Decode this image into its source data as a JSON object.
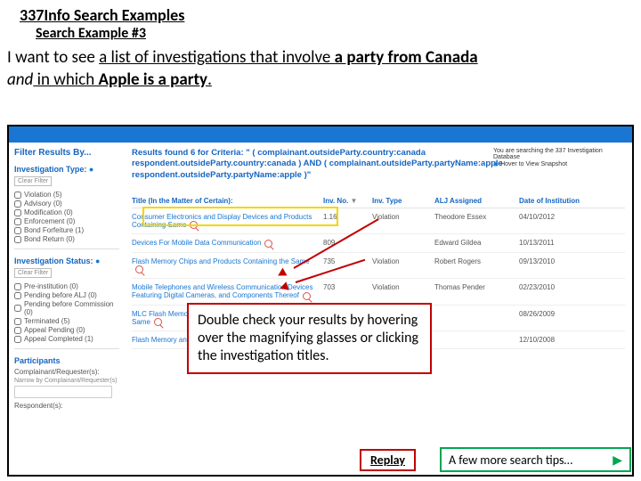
{
  "slide": {
    "title": "337Info Search Examples",
    "subtitle": "Search Example #3",
    "prompt_lead": "I want to see ",
    "prompt_seg1": "a list of investigations that involve ",
    "prompt_seg2": "a party from Canada",
    "prompt_and": "and",
    "prompt_seg3": " in which ",
    "prompt_seg4": "Apple is a party",
    "prompt_period": "."
  },
  "sidebar": {
    "header": "Filter Results By...",
    "group1": "Investigation Type:",
    "clear": "Clear Filter",
    "types": [
      {
        "label": "Violation (5)"
      },
      {
        "label": "Advisory (0)"
      },
      {
        "label": "Modification (0)"
      },
      {
        "label": "Enforcement (0)"
      },
      {
        "label": "Bond Forfeiture (1)"
      },
      {
        "label": "Bond Return (0)"
      }
    ],
    "group2": "Investigation Status:",
    "statuses": [
      {
        "label": "Pre-institution (0)"
      },
      {
        "label": "Pending before ALJ (0)"
      },
      {
        "label": "Pending before Commission (0)"
      },
      {
        "label": "Terminated (5)"
      },
      {
        "label": "Appeal Pending (0)"
      },
      {
        "label": "Appeal Completed (1)"
      }
    ],
    "group3": "Participants",
    "participants_label": "Complainant/Requester(s):",
    "narrow": "Narrow by Complainant/Requester(s)",
    "respondents_label": "Respondent(s):"
  },
  "results": {
    "criteria": "Results found 6 for Criteria: \" ( complainant.outsideParty.country:canada respondent.outsideParty.country:canada ) AND ( complainant.outsideParty.partyName:apple respondent.outsideParty.partyName:apple )\"",
    "aside_line1": "You are searching the 337 Investigation Database",
    "aside_line2": "Hover to View Snapshot",
    "headers": {
      "title": "Title (In the Matter of Certain):",
      "inv": "Inv. No.",
      "type": "Inv. Type",
      "alj": "ALJ Assigned",
      "date": "Date of Institution"
    },
    "rows": [
      {
        "title": "Consumer Electronics and Display Devices and Products Containing Same",
        "inv": "1.16",
        "type": "Violation",
        "alj": "Theodore Essex",
        "date": "04/10/2012"
      },
      {
        "title": "Devices For Mobile Data Communication",
        "inv": "809",
        "type": "",
        "alj": "Edward Gildea",
        "date": "10/13/2011"
      },
      {
        "title": "Flash Memory Chips and Products Containing the Same",
        "inv": "735",
        "type": "Violation",
        "alj": "Robert Rogers",
        "date": "09/13/2010"
      },
      {
        "title": "Mobile Telephones and Wireless Communication Devices Featuring Digital Cameras, and Components Thereof",
        "inv": "703",
        "type": "Violation",
        "alj": "Thomas Pender",
        "date": "02/23/2010"
      },
      {
        "title": "MLC Flash Memory Devices and Products Containing Same",
        "inv": "",
        "type": "",
        "alj": "",
        "date": "08/26/2009"
      },
      {
        "title": "Flash Memory and Products Containing Same",
        "inv": "",
        "type": "",
        "alj": "",
        "date": "12/10/2008"
      }
    ]
  },
  "callout": "Double check your results by hovering over the magnifying glasses or clicking the investigation titles.",
  "buttons": {
    "replay": "Replay",
    "tips": "A few more search tips…"
  }
}
